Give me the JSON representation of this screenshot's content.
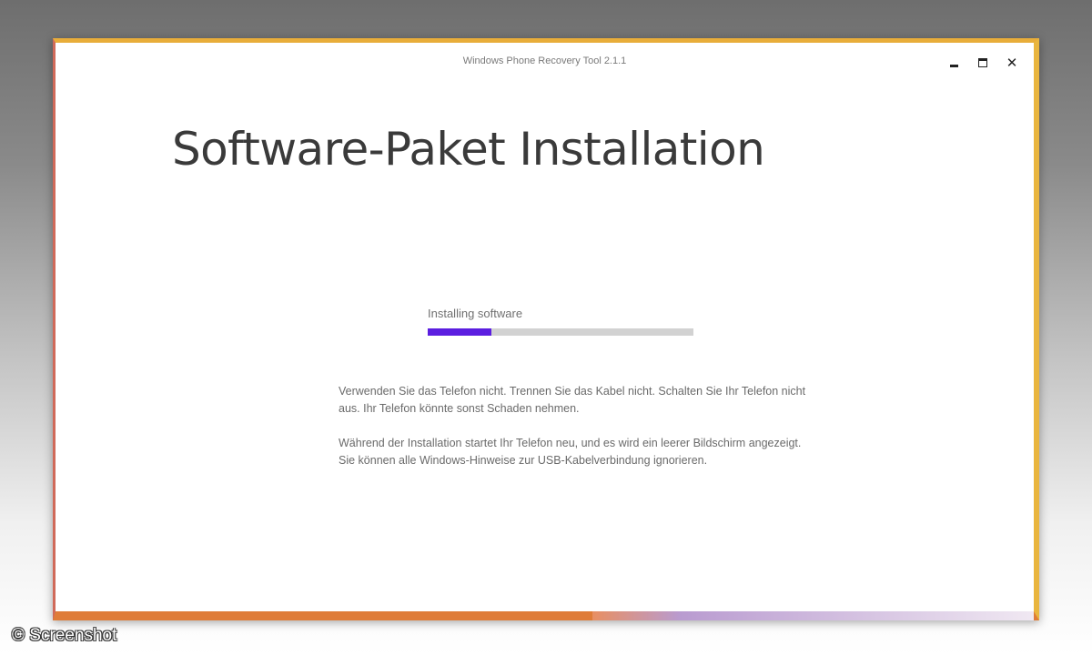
{
  "window": {
    "title": "Windows Phone Recovery Tool 2.1.1"
  },
  "controls": {
    "minimize_icon": "minimize-icon",
    "maximize_icon": "maximize-icon",
    "close_icon": "close-icon",
    "close_glyph": "✕"
  },
  "main": {
    "heading": "Software-Paket Installation",
    "status": "Installing software",
    "progress": {
      "fraction": 0.24,
      "fill_color": "#5b1ee0",
      "track_color": "#d2d2d2"
    },
    "paragraph1": "Verwenden Sie das Telefon nicht. Trennen Sie das Kabel nicht. Schalten Sie Ihr Telefon nicht aus. Ihr Telefon könnte sonst Schaden nehmen.",
    "paragraph2_line1": "Während der Installation startet Ihr Telefon neu, und es wird ein leerer Bildschirm angezeigt.",
    "paragraph2_line2": "Sie können alle Windows-Hinweise zur USB-Kabelverbindung ignorieren."
  },
  "watermark": "© Screenshot"
}
